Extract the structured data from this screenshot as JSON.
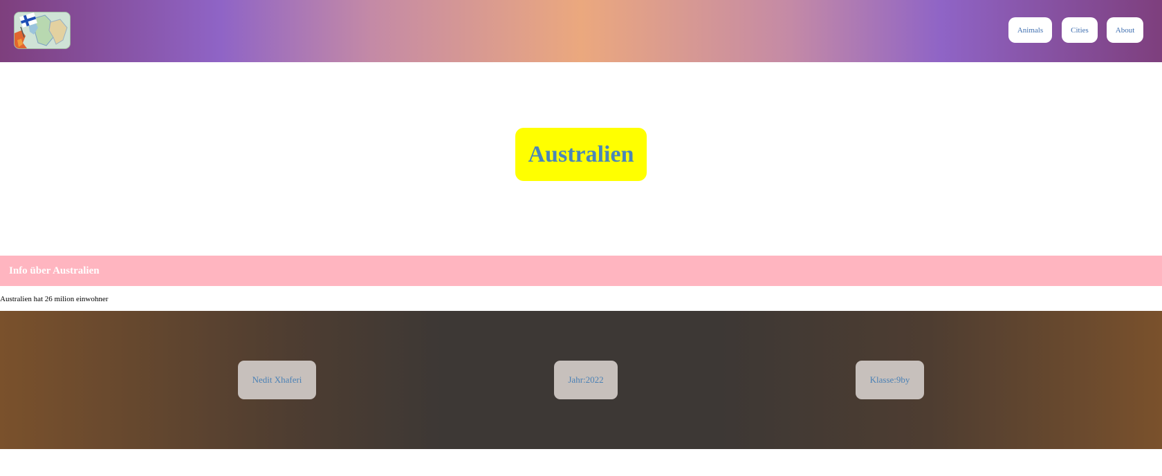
{
  "header": {
    "logo_icon": "finland-map-flag-icon",
    "nav": [
      {
        "label": "Animals"
      },
      {
        "label": "Cities"
      },
      {
        "label": "About"
      }
    ]
  },
  "hero": {
    "title": "Australien"
  },
  "info": {
    "heading": "Info über Australien",
    "text": "Australien hat 26 milion einwohner"
  },
  "footer": {
    "items": [
      {
        "label": "Nedit Xhaferi"
      },
      {
        "label": "Jahr:2022"
      },
      {
        "label": "Klasse:9by"
      }
    ]
  },
  "colors": {
    "hero_bg": "#ffff00",
    "hero_text": "#4a86b8",
    "info_bar": "#ffb5c0",
    "nav_text": "#3f6fb0",
    "footer_box": "#c7c0bc"
  }
}
